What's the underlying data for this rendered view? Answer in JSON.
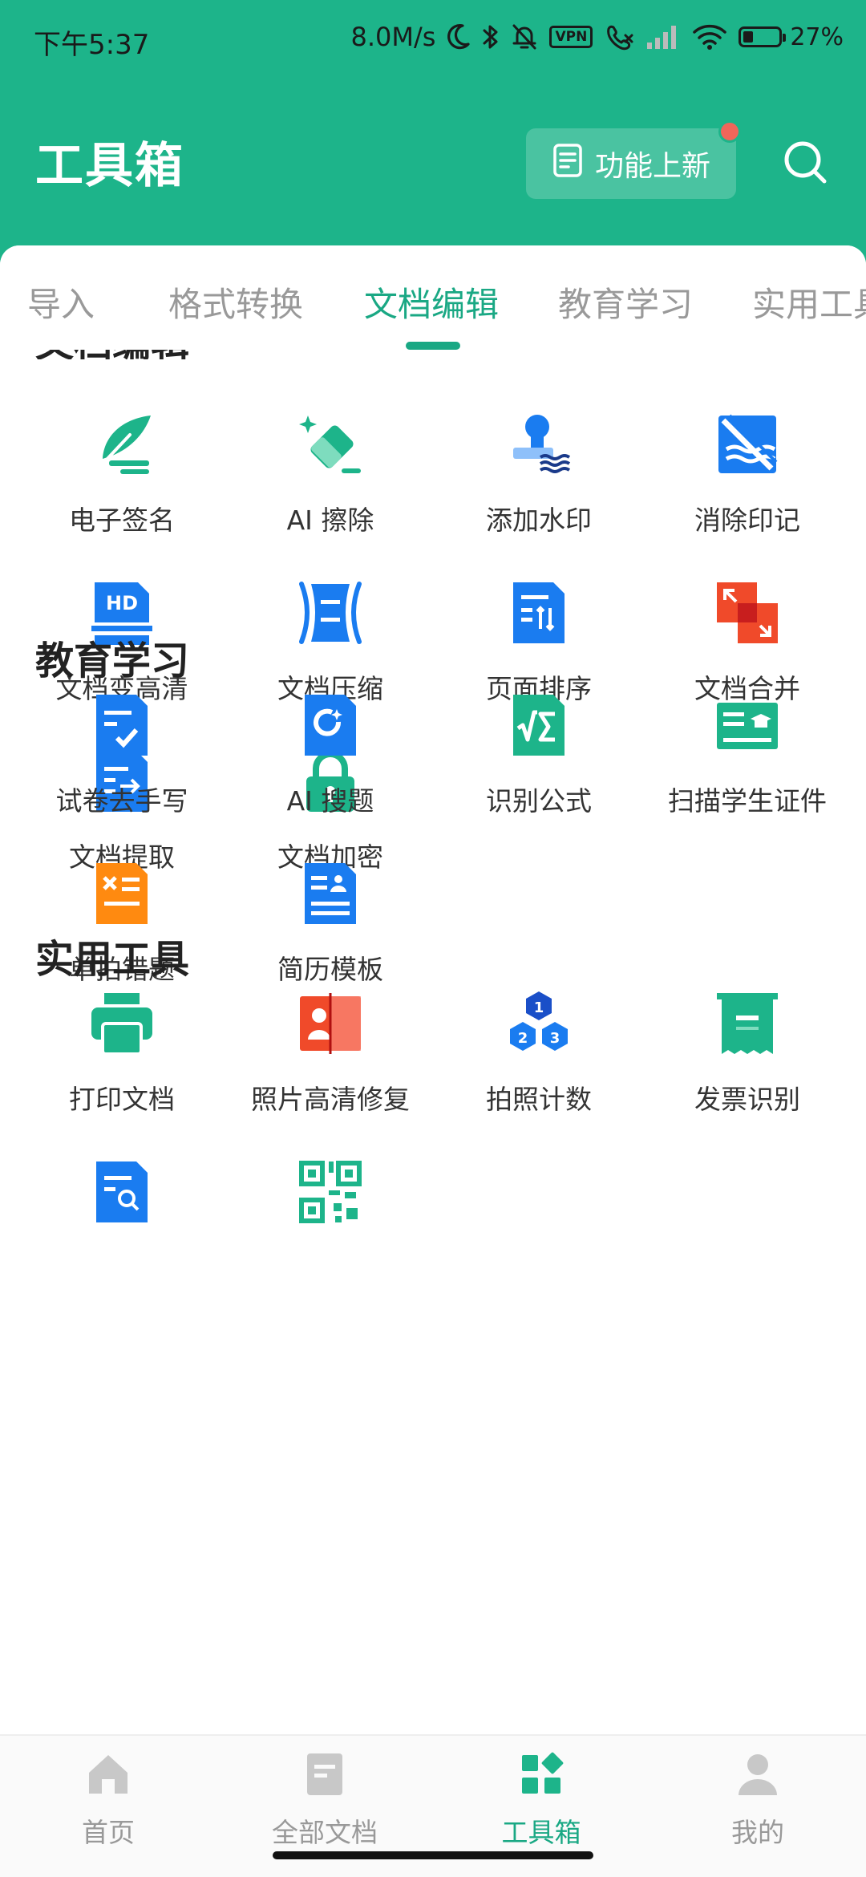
{
  "status_bar": {
    "time": "下午5:37",
    "speed": "8.0M/s",
    "vpn": "VPN",
    "battery": "27%"
  },
  "header": {
    "title": "工具箱",
    "new_button": "功能上新"
  },
  "tabs": [
    "导入",
    "格式转换",
    "文档编辑",
    "教育学习",
    "实用工具"
  ],
  "active_tab": "文档编辑",
  "sections": {
    "doc_edit": {
      "title": "文档编辑",
      "tools": [
        "电子签名",
        "AI 擦除",
        "添加水印",
        "消除印记",
        "文档变高清",
        "文档压缩",
        "页面排序",
        "文档合并",
        "文档提取",
        "文档加密"
      ]
    },
    "education": {
      "title": "教育学习",
      "tools": [
        "试卷去手写",
        "AI 搜题",
        "识别公式",
        "扫描学生证件",
        "单拍错题",
        "简历模板"
      ]
    },
    "utility": {
      "title": "实用工具",
      "tools": [
        "打印文档",
        "照片高清修复",
        "拍照计数",
        "发票识别"
      ]
    }
  },
  "icon_labels": {
    "hd": "HD",
    "count": [
      "1",
      "2",
      "3"
    ]
  },
  "bottom_nav": [
    "首页",
    "全部文档",
    "工具箱",
    "我的"
  ],
  "colors": {
    "brand": "#1db48a",
    "accent_text": "#1aa884",
    "blue": "#1a7cf0",
    "red": "#f04a2a",
    "orange": "#ff8a10",
    "badge": "#f0665a"
  }
}
